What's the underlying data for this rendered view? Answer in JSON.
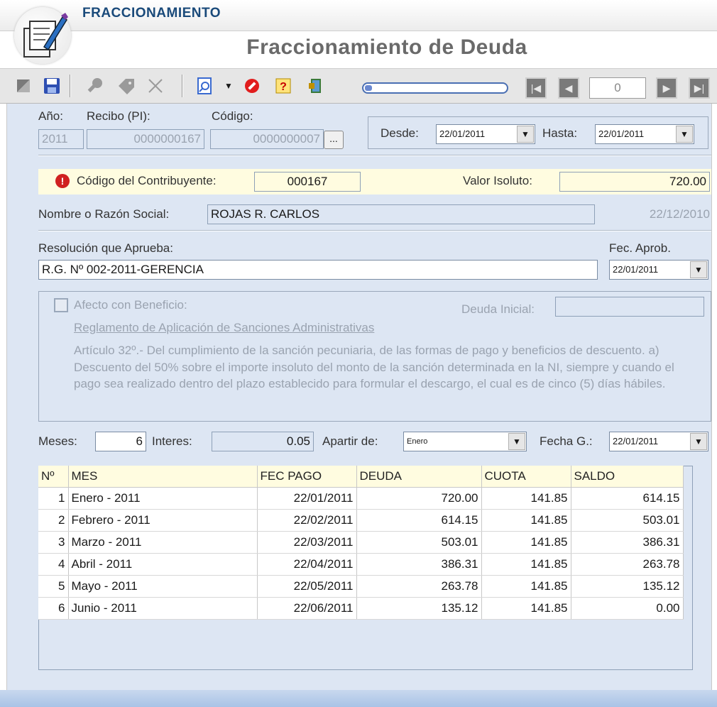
{
  "header": {
    "module_title": "FRACCIONAMIENTO",
    "form_title": "Fraccionamiento de Deuda"
  },
  "toolbar": {
    "icons": [
      "grid-icon",
      "save-icon",
      "wrench-icon",
      "tag-icon",
      "close-icon",
      "zoom-document-icon",
      "dropdown-arrow-icon",
      "cancel-icon",
      "help-icon",
      "exit-door-icon"
    ],
    "progress": 0.05,
    "nav_value": "0"
  },
  "form": {
    "anio_label": "Año:",
    "anio_value": "2011",
    "recibo_label": "Recibo (PI):",
    "recibo_value": "0000000167",
    "codigo_label": "Código:",
    "codigo_value": "0000000007",
    "codigo_btn": "...",
    "desde_label": "Desde:",
    "desde_value": "22/01/2011",
    "hasta_label": "Hasta:",
    "hasta_value": "22/01/2011",
    "contrib_label": "Código del Contribuyente:",
    "contrib_value": "000167",
    "valor_label": "Valor Isoluto:",
    "valor_value": "720.00",
    "nombre_label": "Nombre o Razón Social:",
    "nombre_value": "ROJAS R. CARLOS",
    "nombre_date": "22/12/2010",
    "resolucion_label": "Resolución que Aprueba:",
    "resolucion_value": "R.G. Nº 002-2011-GERENCIA",
    "fecaprob_label": "Fec. Aprob.",
    "fecaprob_value": "22/01/2011",
    "afecto_label": "Afecto con Beneficio:",
    "deuda_inicial_label": "Deuda Inicial:",
    "deuda_inicial_value": "",
    "reglamento_link": "Reglamento de Aplicación de Sanciones Administrativas",
    "articulo_text": "Artículo 32º.- Del cumplimiento de la sanción pecuniaria, de las formas de pago y beneficios de descuento. a) Descuento del 50% sobre el importe insoluto del monto de la sanción determinada en la NI, siempre y cuando el pago sea realizado dentro del plazo establecido para formular el descargo, el cual es de cinco (5) días hábiles.",
    "meses_label": "Meses:",
    "meses_value": "6",
    "interes_label": "Interes:",
    "interes_value": "0.05",
    "apartir_label": "Apartir de:",
    "apartir_value": "Enero",
    "fechag_label": "Fecha G.:",
    "fechag_value": "22/01/2011"
  },
  "table": {
    "headers": [
      "Nº",
      "MES",
      "FEC PAGO",
      "DEUDA",
      "CUOTA",
      "SALDO"
    ],
    "rows": [
      [
        "1",
        "Enero - 2011",
        "22/01/2011",
        "720.00",
        "141.85",
        "614.15"
      ],
      [
        "2",
        "Febrero - 2011",
        "22/02/2011",
        "614.15",
        "141.85",
        "503.01"
      ],
      [
        "3",
        "Marzo - 2011",
        "22/03/2011",
        "503.01",
        "141.85",
        "386.31"
      ],
      [
        "4",
        "Abril - 2011",
        "22/04/2011",
        "386.31",
        "141.85",
        "263.78"
      ],
      [
        "5",
        "Mayo - 2011",
        "22/05/2011",
        "263.78",
        "141.85",
        "135.12"
      ],
      [
        "6",
        "Junio - 2011",
        "22/06/2011",
        "135.12",
        "141.85",
        "0.00"
      ]
    ]
  }
}
